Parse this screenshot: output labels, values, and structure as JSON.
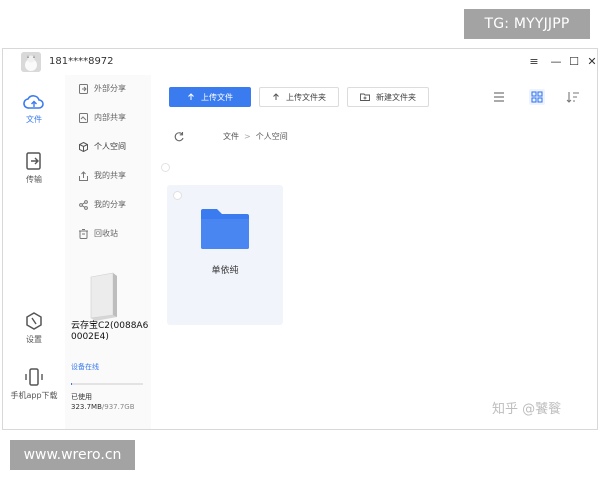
{
  "watermarks": {
    "top": "TG: MYYJJPP",
    "bottom": "www.wrero.cn",
    "zhihu": "知乎 @饕餮"
  },
  "window": {
    "account": "181****8972",
    "controls": {
      "menu": "≡",
      "minimize": "—",
      "maximize": "☐",
      "close": "✕"
    }
  },
  "leftbar": {
    "items": [
      {
        "label": "文件",
        "icon": "cloud-icon"
      },
      {
        "label": "传输",
        "icon": "transfer-icon"
      },
      {
        "label": "设置",
        "icon": "settings-icon"
      },
      {
        "label": "手机app下载",
        "icon": "phone-icon"
      }
    ]
  },
  "nav": {
    "items": [
      {
        "label": "外部分享",
        "icon": "external-share-icon"
      },
      {
        "label": "内部共享",
        "icon": "internal-share-icon"
      },
      {
        "label": "个人空间",
        "icon": "cube-icon"
      },
      {
        "label": "我的共享",
        "icon": "upload-share-icon"
      },
      {
        "label": "我的分享",
        "icon": "share-icon"
      },
      {
        "label": "回收站",
        "icon": "trash-icon"
      }
    ]
  },
  "device": {
    "name": "云存宝C2(0088A60002E4)",
    "status": "设备在线",
    "usage_label": "已使用",
    "used": "323.7MB",
    "total": "937.7GB",
    "used_fraction": 0.0004
  },
  "toolbar": {
    "upload_file": "上传文件",
    "upload_folder": "上传文件夹",
    "new_folder": "新建文件夹"
  },
  "breadcrumb": {
    "root": "文件",
    "separator": ">",
    "current": "个人空间"
  },
  "files": [
    {
      "name": "单依纯",
      "type": "folder"
    }
  ],
  "colors": {
    "accent": "#3a7bf0",
    "folder": "#3a7bf0"
  }
}
